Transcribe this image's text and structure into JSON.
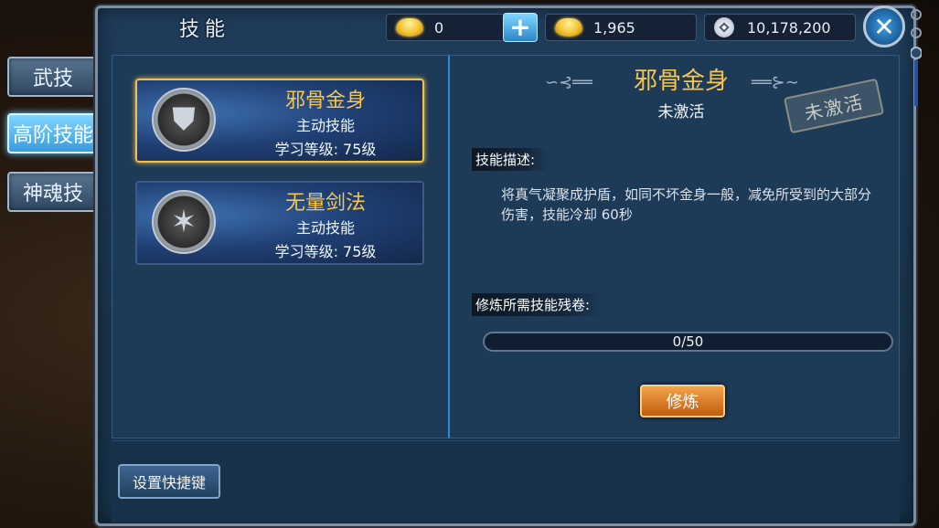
{
  "sidebar": {
    "tabs": [
      {
        "label": "武技",
        "active": false
      },
      {
        "label": "高阶技能",
        "active": true
      },
      {
        "label": "神魂技",
        "active": false
      }
    ]
  },
  "header": {
    "title": "技能",
    "currencies": [
      {
        "icon": "gold-ingot-icon",
        "value": "0"
      },
      {
        "icon": "locked-gold-ingot-icon",
        "value": "1,965"
      },
      {
        "icon": "silver-coin-icon",
        "value": "10,178,200"
      }
    ],
    "add_label": "+"
  },
  "skills": [
    {
      "name": "邪骨金身",
      "type": "主动技能",
      "level": "学习等级: 75级",
      "icon": "shield-icon",
      "selected": true
    },
    {
      "name": "无量剑法",
      "type": "主动技能",
      "level": "学习等级: 75级",
      "icon": "sword-burst-icon",
      "selected": false
    }
  ],
  "detail": {
    "name": "邪骨金身",
    "status": "未激活",
    "stamp": "未激活",
    "desc_label": "技能描述:",
    "description": "将真气凝聚成护盾，如同不坏金身一般，减免所受到的大部分伤害，技能冷却 60秒",
    "req_label": "修炼所需技能残卷:",
    "progress": "0/50",
    "progress_fraction": 0,
    "train_label": "修炼"
  },
  "footer": {
    "shortcut_label": "设置快捷键"
  },
  "colors": {
    "accent_gold": "#f7c64a",
    "accent_blue": "#3a9be0",
    "button_orange": "#c15d10"
  }
}
